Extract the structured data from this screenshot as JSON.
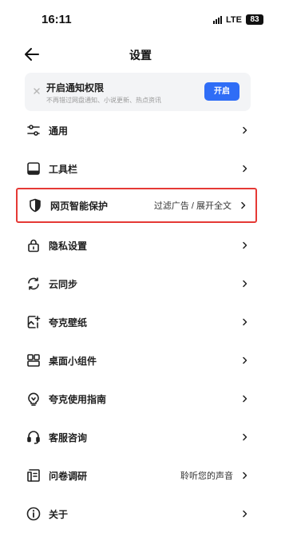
{
  "status_bar": {
    "time": "16:11",
    "network": "LTE",
    "battery": "83"
  },
  "header": {
    "title": "设置"
  },
  "notice": {
    "title": "开启通知权限",
    "subtitle": "不再错过网盘通知、小说更新、热点资讯",
    "button_label": "开启",
    "button_color": "#2f6df6"
  },
  "menu": [
    {
      "label": "通用",
      "value": "",
      "icon": "sliders-icon"
    },
    {
      "label": "工具栏",
      "value": "",
      "icon": "toolbar-icon"
    },
    {
      "label": "网页智能保护",
      "value": "过滤广告 / 展开全文",
      "icon": "shield-icon",
      "highlighted": true
    },
    {
      "label": "隐私设置",
      "value": "",
      "icon": "lock-icon"
    },
    {
      "label": "云同步",
      "value": "",
      "icon": "sync-icon"
    },
    {
      "label": "夸克壁纸",
      "value": "",
      "icon": "wallpaper-icon"
    },
    {
      "label": "桌面小组件",
      "value": "",
      "icon": "widgets-icon"
    },
    {
      "label": "夸克使用指南",
      "value": "",
      "icon": "lightbulb-icon"
    },
    {
      "label": "客服咨询",
      "value": "",
      "icon": "headset-icon"
    },
    {
      "label": "问卷调研",
      "value": "聆听您的声音",
      "icon": "survey-icon"
    },
    {
      "label": "关于",
      "value": "",
      "icon": "info-icon"
    }
  ],
  "highlight_color": "#e53935"
}
